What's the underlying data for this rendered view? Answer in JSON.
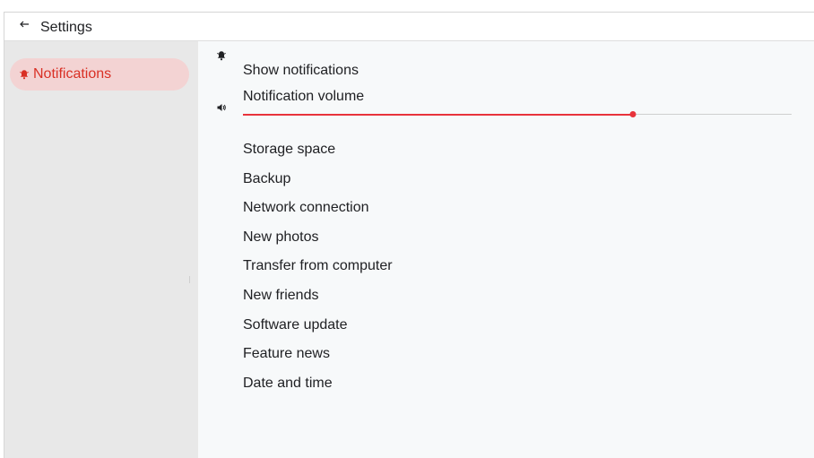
{
  "header": {
    "title": "Settings",
    "back_icon": "arrow-back-icon"
  },
  "sidebar": {
    "items": [
      {
        "label": "Notifications",
        "icon": "bell-icon",
        "active": true
      }
    ]
  },
  "settings": {
    "show_notifications": {
      "label": "Show notifications",
      "icon": "bell-icon",
      "on": true
    },
    "notification_volume": {
      "label": "Notification volume",
      "icon": "speaker-icon",
      "value_fraction": 0.71
    },
    "toggles": [
      {
        "label": "Storage space",
        "on": true
      },
      {
        "label": "Backup",
        "on": true
      },
      {
        "label": "Network connection",
        "on": false
      },
      {
        "label": "New photos",
        "on": true
      },
      {
        "label": "Transfer from computer",
        "on": true
      },
      {
        "label": "New friends",
        "on": true
      },
      {
        "label": "Software update",
        "on": true
      },
      {
        "label": "Feature news",
        "on": true
      },
      {
        "label": "Date and time",
        "on": true
      }
    ]
  },
  "colors": {
    "accent": "#e8333b",
    "accent_light": "#f3d3d3",
    "sidebar_bg": "#e8e8e8"
  }
}
